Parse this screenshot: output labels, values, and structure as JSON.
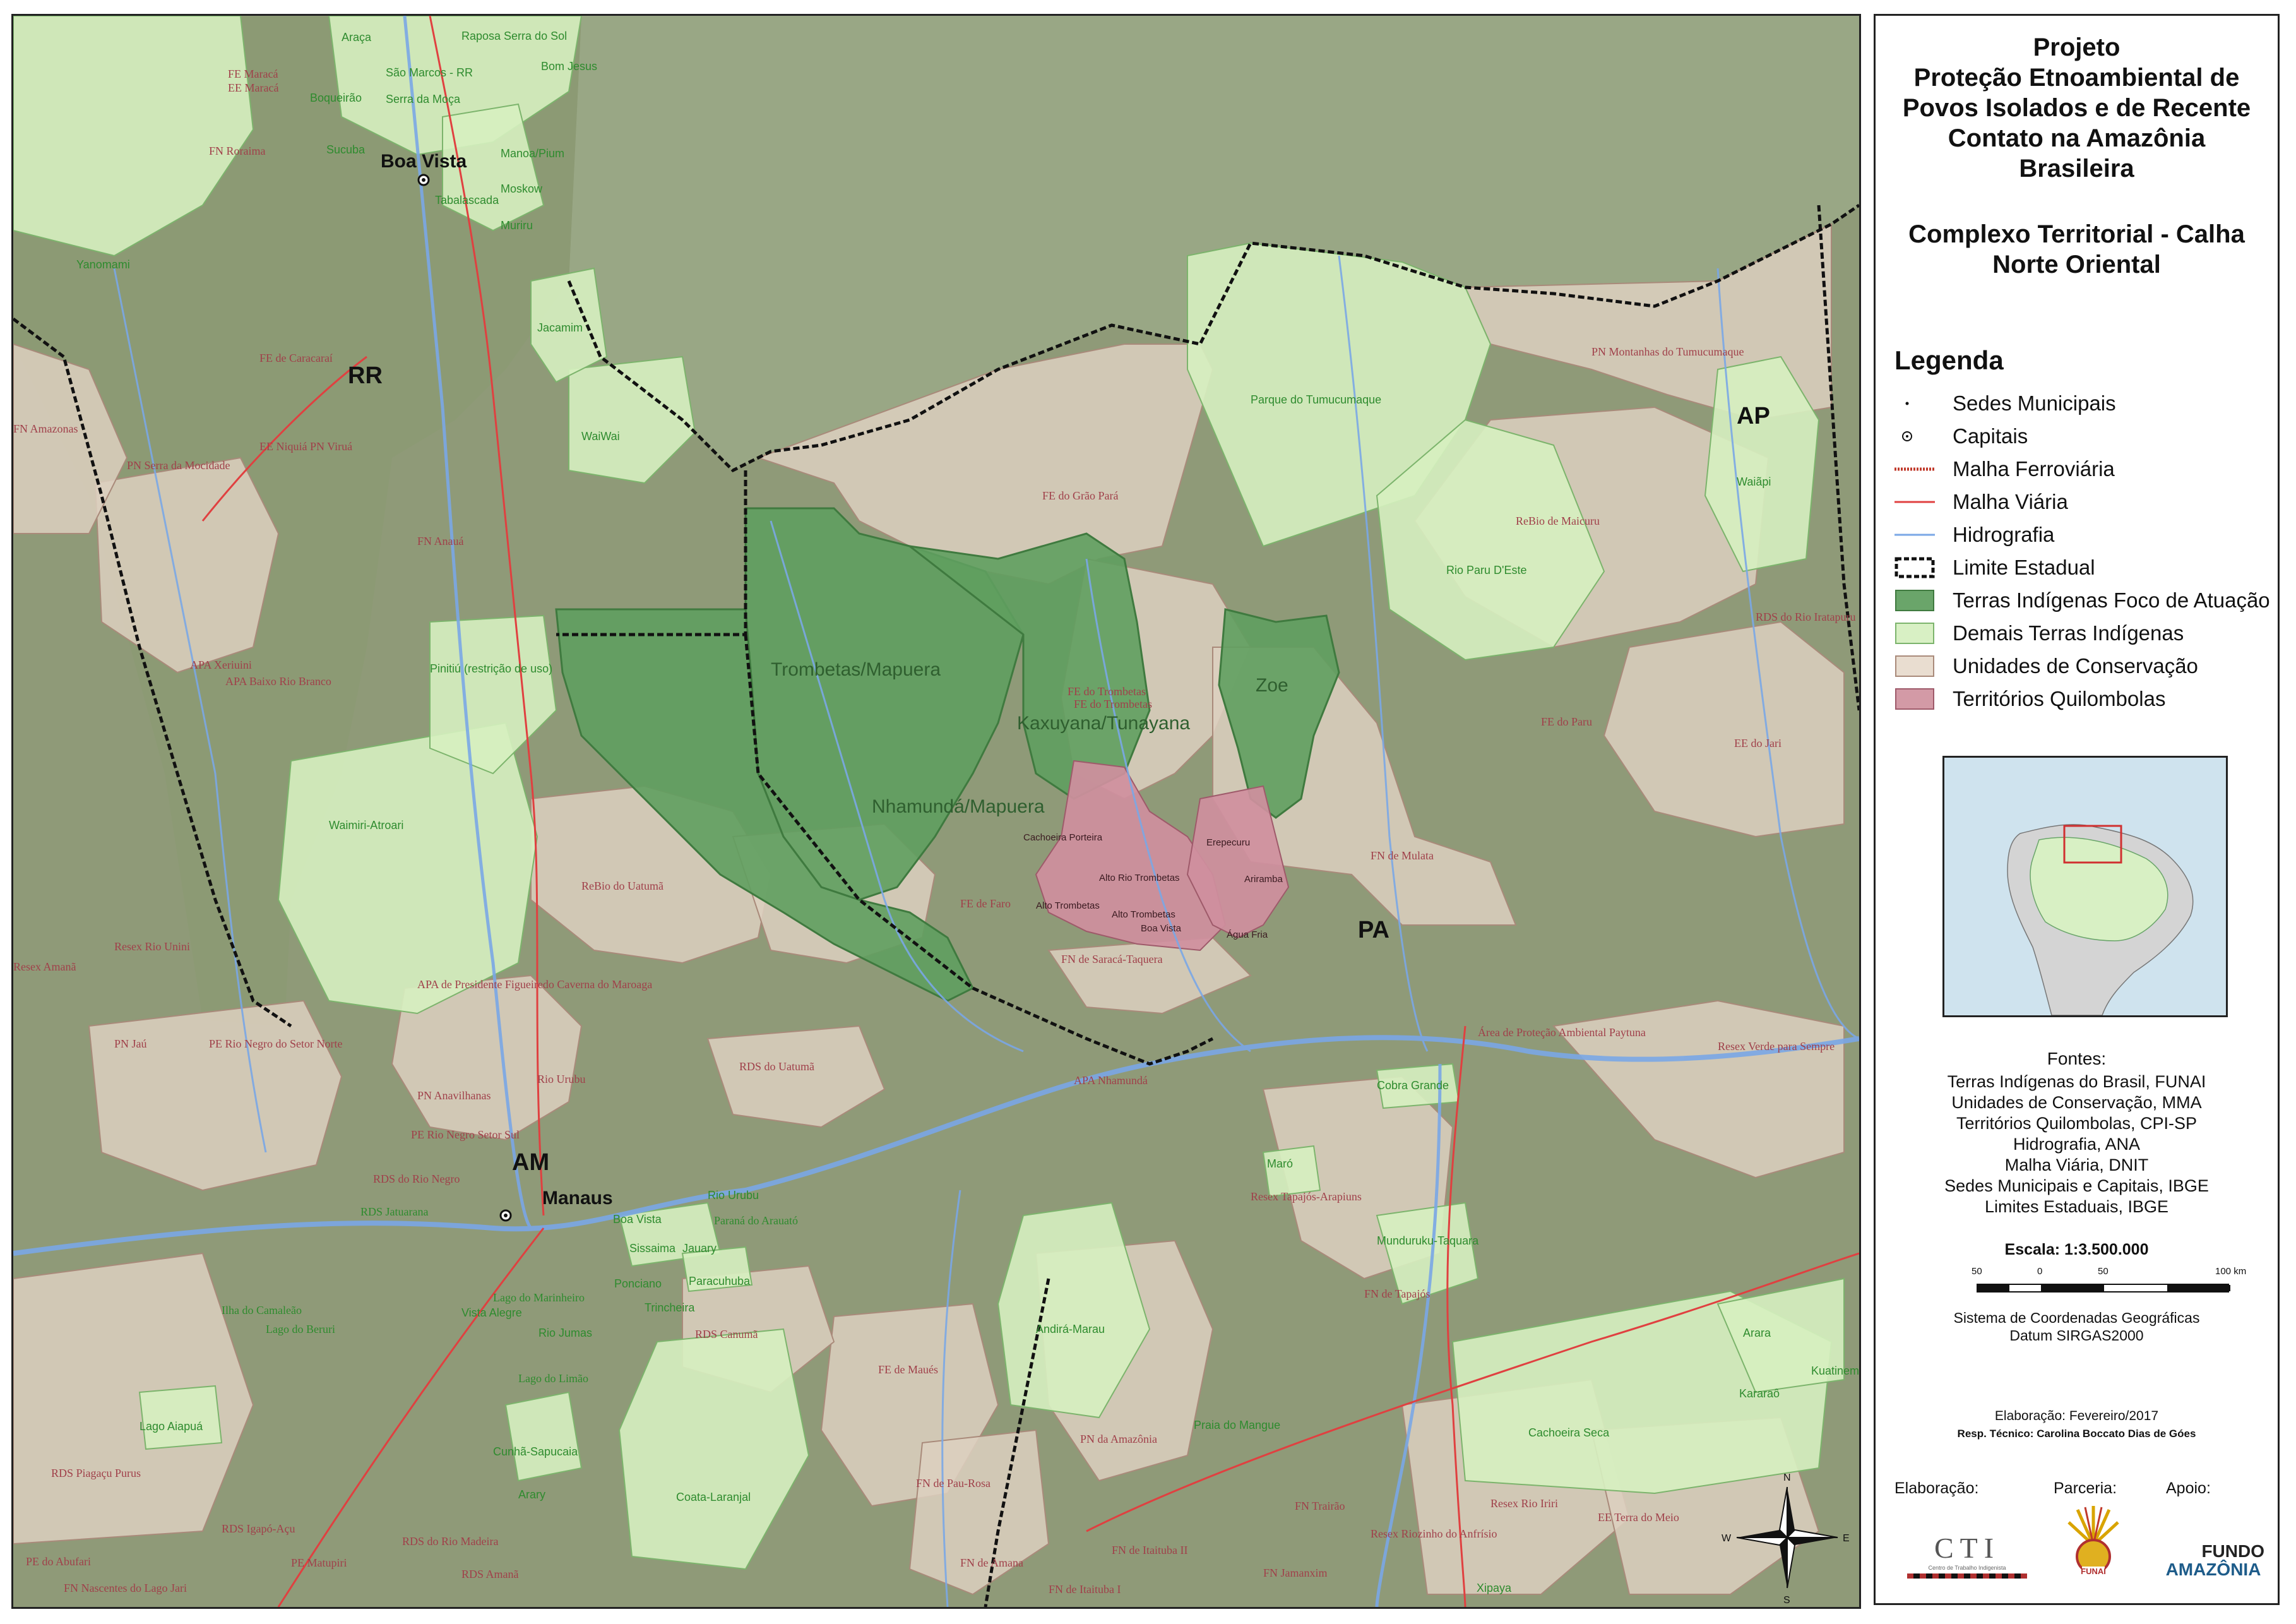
{
  "map": {
    "states": [
      {
        "key": "RR",
        "label": "RR"
      },
      {
        "key": "AP",
        "label": "AP"
      },
      {
        "key": "PA",
        "label": "PA"
      },
      {
        "key": "AM",
        "label": "AM"
      }
    ],
    "cities": [
      {
        "label": "Boa Vista"
      },
      {
        "label": "Manaus"
      }
    ],
    "focus_lands": [
      "Trombetas/Mapuera",
      "Kaxuyana/Tunayana",
      "Nhamundá/Mapuera",
      "Zoe"
    ],
    "other_lands": [
      "Yanomami",
      "Raposa Serra do Sol",
      "São Marcos - RR",
      "Jacamim",
      "WaiWai",
      "Waimiri-Atroari",
      "Parque do Tumucumaque",
      "Rio Paru D'Este",
      "Waiãpi",
      "Andirá-Marau",
      "Coata-Laranjal",
      "Cachoeira Seca",
      "Arara",
      "Kararaô",
      "Kuatinemu",
      "Munduruku-Taquara",
      "Maró",
      "Cobra Grande",
      "Cunhã-Sapucaia",
      "Lago Aiapuá",
      "Pinitiú (restrição de uso)",
      "Araça",
      "Boqueirão",
      "Serra da Moça",
      "Bom Jesus",
      "Manoa/Pium",
      "Moskow",
      "Muriru",
      "Tabalascada",
      "Sucuba",
      "Rio Urubu",
      "Sissaima",
      "Paracuhuba",
      "Trincheira",
      "Rio Jumas",
      "Vista Alegre",
      "Ponciano",
      "Praia do Mangue",
      "Xipaya",
      "Arary",
      "Boa Vista",
      "Jauary"
    ],
    "conservation_units": [
      "FE do Grão Pará",
      "PN Montanhas do Tumucumaque",
      "ReBio de Maicuru",
      "RDS do Rio Iratapuru",
      "FE do Paru",
      "EE do Jari",
      "FE do Trombetas",
      "ReBio do Uatumã",
      "FN de Mulata",
      "FN de Saracá-Taquera",
      "FE de Faro",
      "APA Nhamundá",
      "Área de Proteção Ambiental Paytuna",
      "Resex Verde para Sempre",
      "Resex Tapajós-Arapiuns",
      "FN de Tapajós",
      "PN da Amazônia",
      "FN de Pau-Rosa",
      "FE de Maués",
      "RDS do Uatumã",
      "RDS Canumã",
      "PN Anavilhanas",
      "PE Rio Negro Setor Sul",
      "RDS do Rio Negro",
      "PE Rio Negro do Setor Norte",
      "APA de Presidente Figueiredo Caverna do Maroaga",
      "Resex Rio Unini",
      "PN Jaú",
      "FE de Caracaraí",
      "EE Niquiá",
      "PN Serra da Mocidade",
      "PN Viruá",
      "FN Amazonas",
      "FN Anauá",
      "APA Xeriuini",
      "APA Baixo Rio Branco",
      "FN Roraima",
      "FE Maracá",
      "EE Maracá",
      "FN Trairão",
      "Resex Riozinho do Anfrísio",
      "Resex Rio Iriri",
      "EE Terra do Meio",
      "FN de Itaituba II",
      "FN de Itaituba I",
      "FN de Amana",
      "FN Jamanxim",
      "RDS Piagaçu Purus",
      "RDS Igapó-Açu",
      "RDS do Rio Madeira",
      "PE Matupiri",
      "RDS Amanã",
      "Lago do Marinheiro",
      "Lago do Beruri",
      "Lago do Limão",
      "Ilha do Camaleão",
      "Paraná do Arauató",
      "Rio Urubu",
      "FE do Trombetas",
      "FN Nascentes do Lago Jari",
      "PE do Abufari",
      "RDS Jatuarana",
      "Resex Amanã"
    ],
    "quilombola": [
      "Cachoeira Porteira",
      "Alto Trombetas",
      "Alto Trombetas",
      "Boa Vista",
      "Erepecuru",
      "Água Fria",
      "Ariramba",
      "Alto Rio Trombetas"
    ]
  },
  "panel": {
    "title_lines": [
      "Projeto",
      "Proteção Etnoambiental de",
      "Povos Isolados e de Recente",
      "Contato na Amazônia",
      "Brasileira"
    ],
    "subtitle_lines": [
      "Complexo Territorial - Calha",
      "Norte Oriental"
    ],
    "legend_title": "Legenda",
    "legend": [
      {
        "label": "Sedes Municipais",
        "symbol": "dot"
      },
      {
        "label": "Capitais",
        "symbol": "circle-dot"
      },
      {
        "label": "Malha Ferroviária",
        "symbol": "railway",
        "color": "#c0392b"
      },
      {
        "label": "Malha Viária",
        "symbol": "line",
        "color": "#e04040"
      },
      {
        "label": "Hidrografia",
        "symbol": "line",
        "color": "#7aa7e6"
      },
      {
        "label": "Limite Estadual",
        "symbol": "state-boundary"
      },
      {
        "label": "Terras Indígenas Foco de Atuação",
        "symbol": "fill",
        "color": "#6aa56a"
      },
      {
        "label": "Demais Terras Indígenas",
        "symbol": "fill",
        "color": "#d8f0c4"
      },
      {
        "label": "Unidades de Conservação",
        "symbol": "fill",
        "color": "#e9ddd0"
      },
      {
        "label": "Territórios Quilombolas",
        "symbol": "fill",
        "color": "#d39aa6"
      }
    ],
    "sources_title": "Fontes:",
    "sources": [
      "Terras Indígenas do Brasil, FUNAI",
      "Unidades de Conservação, MMA",
      "Territórios Quilombolas, CPI-SP",
      "Hidrografia, ANA",
      "Malha Viária, DNIT",
      "Sedes Municipais e Capitais, IBGE",
      "Limites Estaduais, IBGE"
    ],
    "scale_title": "Escala: 1:3.500.000",
    "scale_ticks": [
      "50",
      "0",
      "50",
      "100 km"
    ],
    "crs_lines": [
      "Sistema de Coordenadas Geográficas",
      "Datum SIRGAS2000"
    ],
    "elaboration_date": "Elaboração: Fevereiro/2017",
    "responsible": "Resp. Técnico: Carolina Boccato Dias de Góes",
    "credits": {
      "elaboracao": "Elaboração:",
      "parceria": "Parceria:",
      "apoio": "Apoio:"
    },
    "logos": {
      "cti": "CTI",
      "cti_sub": "Centro de Trabalho Indigenista",
      "funai": "FUNAI",
      "fundo_line1": "FUNDO",
      "fundo_line2": "AMAZÔNIA"
    }
  },
  "compass": {
    "n": "N",
    "s": "S",
    "e": "E",
    "w": "W"
  },
  "colors": {
    "base_green": "#8f9a78",
    "guyana_shield": "#96a884",
    "focus_land": "#5f9f5f",
    "other_land": "#d6efc0",
    "conservation": "#ddd0bf",
    "quilombola": "#cf8f9e",
    "river": "#7aa7e6",
    "road": "#e04040",
    "label_green": "#2e8b2e",
    "label_brown": "#a0404a"
  }
}
